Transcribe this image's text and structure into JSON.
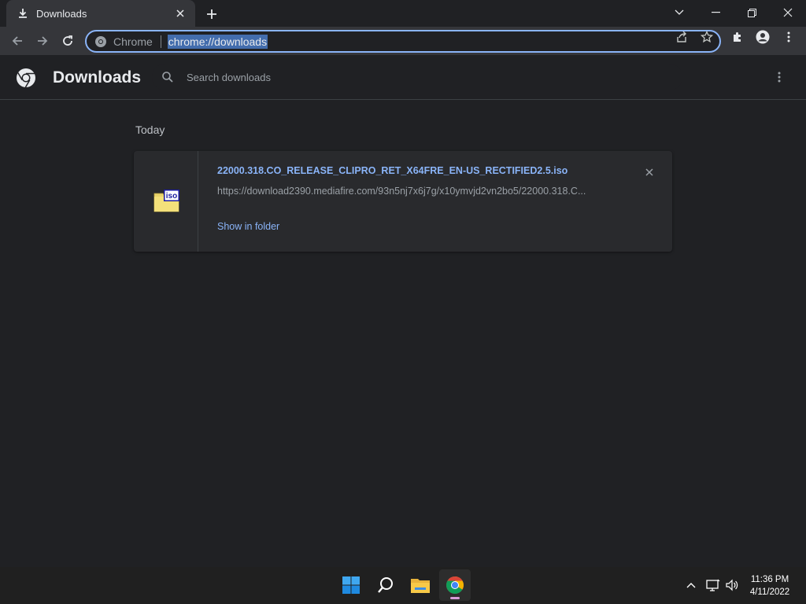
{
  "tab": {
    "title": "Downloads",
    "icon": "download-icon"
  },
  "omnibox": {
    "site_label": "Chrome",
    "url": "chrome://downloads"
  },
  "page": {
    "title": "Downloads",
    "search_placeholder": "Search downloads"
  },
  "downloads": {
    "date_heading": "Today",
    "items": [
      {
        "file_name": "22000.318.CO_RELEASE_CLIPRO_RET_X64FRE_EN-US_RECTIFIED2.5.iso",
        "url": "https://download2390.mediafire.com/93n5nj7x6j7g/x10ymvjd2vn2bo5/22000.318.C...",
        "action_label": "Show in folder",
        "file_icon_label": "iso"
      }
    ]
  },
  "taskbar": {
    "time": "11:36 PM",
    "date": "4/11/2022"
  },
  "colors": {
    "accent": "#8ab4f8",
    "background": "#202124",
    "card": "#292a2d",
    "toolbar": "#35363a"
  }
}
